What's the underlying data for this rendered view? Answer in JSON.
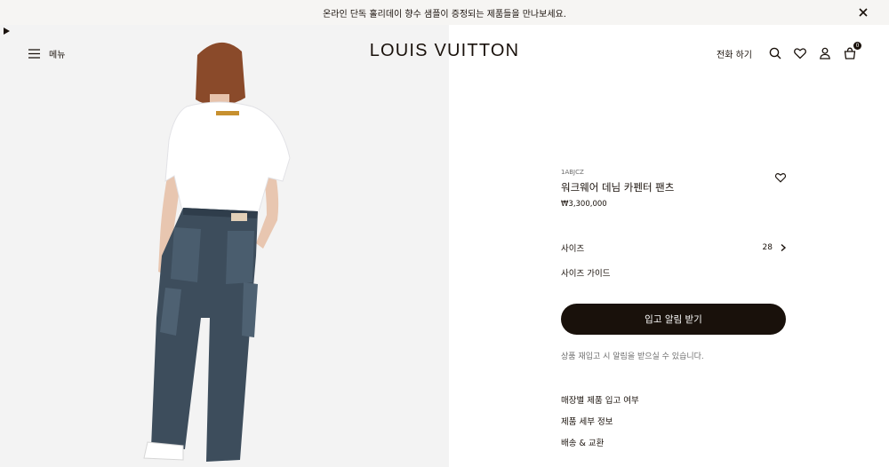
{
  "banner": {
    "message": "온라인 단독 홀리데이 향수 샘플이 증정되는 제품들을 만나보세요."
  },
  "header": {
    "menu_label": "메뉴",
    "logo": "LOUIS VUITTON",
    "call_label": "전화 하기",
    "cart_count": "0"
  },
  "product": {
    "sku": "1ABJCZ",
    "name": "워크웨어 데님 카펜터 팬츠",
    "price": "₩3,300,000",
    "size_label": "사이즈",
    "size_value": "28",
    "size_guide": "사이즈 가이드",
    "notify_button": "입고 알림 받기",
    "notify_note": "상품 재입고 시 알림을 받으실 수 있습니다.",
    "links": [
      "매장별 제품 입고 여부",
      "제품 세부 정보",
      "배송 & 교환"
    ]
  },
  "colors": {
    "brand_dark": "#19110b",
    "banner_bg": "#f6f5f3",
    "image_bg": "#f3f3f3"
  },
  "icons": [
    "close-icon",
    "hamburger-menu-icon",
    "search-icon",
    "heart-icon",
    "account-icon",
    "cart-icon",
    "chevron-right-icon",
    "play-icon"
  ]
}
